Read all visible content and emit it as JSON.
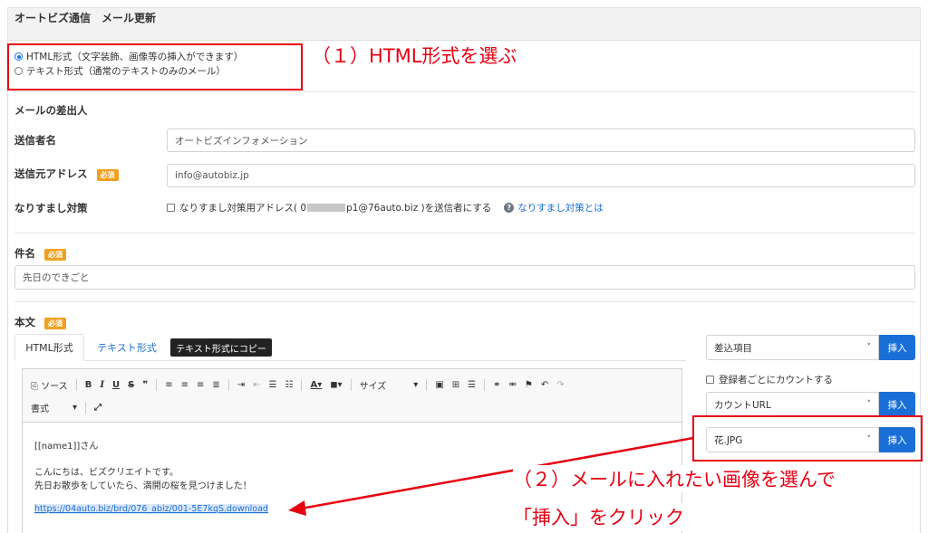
{
  "header": {
    "title": "オートビズ通信　メール更新"
  },
  "format": {
    "html_option": "HTML形式（文字装飾、画像等の挿入ができます）",
    "text_option": "テキスト形式（通常のテキストのみのメール）"
  },
  "annotations": {
    "step1": "（１）HTML形式を選ぶ",
    "step2_line1": "（２）メールに入れたい画像を選んで",
    "step2_line2": "「挿入」をクリック"
  },
  "sender": {
    "section_title": "メールの差出人",
    "name_label": "送信者名",
    "name_value": "オートビズインフォメーション",
    "from_label": "送信元アドレス",
    "from_value": "info@autobiz.jp",
    "spoof_label": "なりすまし対策",
    "spoof_checkbox_prefix": "なりすまし対策用アドレス( 0",
    "spoof_checkbox_suffix": "p1@76auto.biz )を送信者にする",
    "spoof_help_link": "なりすまし対策とは"
  },
  "badges": {
    "required": "必須"
  },
  "subject": {
    "label": "件名",
    "value": "先日のできごと"
  },
  "body": {
    "label": "本文",
    "tabs": [
      "HTML形式",
      "テキスト形式"
    ],
    "copy_tooltip": "テキスト形式にコピー",
    "toolbar": {
      "source": "ソース",
      "size": "サイズ",
      "format": "書式"
    },
    "content": {
      "line1": "[[name1]]さん",
      "line2": "こんにちは、ビズクリエイトです。",
      "line3": "先日お散歩をしていたら、満開の桜を見つけました！",
      "link": "https://04auto.biz/brd/076_abiz/001-5E7kqS.download"
    }
  },
  "right_panel": {
    "insert_field": "差込項目",
    "insert_button": "挿入",
    "count_checkbox": "登録者ごとにカウントする",
    "count_url": "カウントURL",
    "image_select": "花.JPG"
  },
  "colors": {
    "accent": "#1a6fd6",
    "annotation": "#e60012",
    "badge": "#f0a020"
  }
}
